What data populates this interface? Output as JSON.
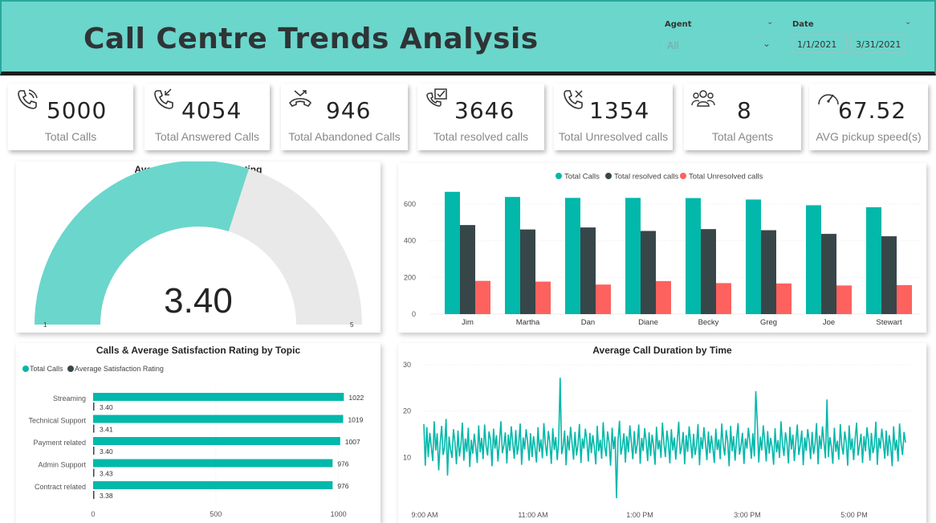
{
  "header": {
    "title": "Call Centre Trends Analysis",
    "agent_label": "Agent",
    "agent_value": "All",
    "date_label": "Date",
    "date_start": "1/1/2021",
    "date_end": "3/31/2021"
  },
  "kpis": [
    {
      "value": "5000",
      "label": "Total Calls",
      "icon": "phone-call-icon"
    },
    {
      "value": "4054",
      "label": "Total Answered Calls",
      "icon": "phone-incoming-icon"
    },
    {
      "value": "946",
      "label": "Total Abandoned Calls",
      "icon": "phone-hangup-icon"
    },
    {
      "value": "3646",
      "label": "Total resolved calls",
      "icon": "resolved-check-icon"
    },
    {
      "value": "1354",
      "label": "Total Unresolved calls",
      "icon": "phone-missed-icon"
    },
    {
      "value": "8",
      "label": "Total Agents",
      "icon": "agents-group-icon"
    },
    {
      "value": "67.52",
      "label": "AVG pickup speed(s)",
      "icon": "speedometer-icon"
    }
  ],
  "colors": {
    "teal": "#01b8aa",
    "dark": "#374649",
    "red": "#fd625e",
    "gauge_fill": "#6bd6cc",
    "gauge_bg": "#e9e9e9"
  },
  "chart_data": [
    {
      "type": "gauge",
      "title": "Average Satisfaction Rating",
      "value": 3.4,
      "value_label": "3.40",
      "min": 1,
      "max": 5,
      "min_label": "1",
      "max_label": "5"
    },
    {
      "type": "bar",
      "title": "",
      "categories": [
        "Jim",
        "Martha",
        "Dan",
        "Diane",
        "Becky",
        "Greg",
        "Joe",
        "Stewart"
      ],
      "series": [
        {
          "name": "Total Calls",
          "values": [
            666,
            638,
            633,
            633,
            632,
            624,
            593,
            582
          ]
        },
        {
          "name": "Total resolved calls",
          "values": [
            485,
            461,
            472,
            453,
            463,
            457,
            437,
            424
          ]
        },
        {
          "name": "Total Unresolved calls",
          "values": [
            181,
            177,
            161,
            180,
            169,
            167,
            156,
            158
          ]
        }
      ],
      "ylim": [
        0,
        700
      ],
      "yticks": [
        0,
        200,
        400,
        600
      ],
      "legend": "top-center"
    },
    {
      "type": "bar",
      "orientation": "horizontal",
      "title": "Calls & Average Satisfaction Rating by Topic",
      "categories": [
        "Streaming",
        "Technical Support",
        "Payment related",
        "Admin Support",
        "Contract related"
      ],
      "series": [
        {
          "name": "Total Calls",
          "values": [
            1022,
            1019,
            1007,
            976,
            976
          ]
        },
        {
          "name": "Average Satisfaction Rating",
          "values": [
            3.4,
            3.41,
            3.4,
            3.43,
            3.38
          ]
        }
      ],
      "value_labels": {
        "calls": [
          "1022",
          "1019",
          "1007",
          "976",
          "976"
        ],
        "rating": [
          "3.40",
          "3.41",
          "3.40",
          "3.43",
          "3.38"
        ]
      },
      "xlim": [
        0,
        1100
      ],
      "xticks": [
        0,
        500,
        1000
      ],
      "legend": "top-left"
    },
    {
      "type": "line",
      "title": "Average Call Duration  by Time",
      "xlabels": [
        "9:00 AM",
        "11:00 AM",
        "1:00 PM",
        "3:00 PM",
        "5:00 PM"
      ],
      "x_range_hours": [
        9,
        18.5
      ],
      "ylim": [
        0,
        30
      ],
      "yticks": [
        10,
        20,
        30
      ],
      "series": [
        {
          "values": [
            17.2,
            8.2,
            16.5,
            10.1,
            15.3,
            12.4,
            9.2,
            17.8,
            11.5,
            15.2,
            7.2,
            13.1,
            16.8,
            10.5,
            12.2,
            18.3,
            6.1,
            14.5,
            11.8,
            9.9,
            16.1,
            13.2,
            8.5,
            15.8,
            10.2,
            12.7,
            17.5,
            9.3,
            14.1,
            11.2,
            16.4,
            7.9,
            13.8,
            10.8,
            15.1,
            12.3,
            8.8,
            16.9,
            11.1,
            14.2,
            9.6,
            17.1,
            12.5,
            10.4,
            15.6,
            13.7,
            8.1,
            16.2,
            11.9,
            14.8,
            9.1,
            13.5,
            17.8,
            10.9,
            12.6,
            15.4,
            8.7,
            14.9,
            11.4,
            16.7,
            13.1,
            9.7,
            15.9,
            10.6,
            12.9,
            17.3,
            8.4,
            14.3,
            11.7,
            16.1,
            13.4,
            9.3,
            15.2,
            10.1,
            14.6,
            12.1,
            8.9,
            16.5,
            11.2,
            13.9,
            9.8,
            17.4,
            12.8,
            10.3,
            15.7,
            13.3,
            8.6,
            16.3,
            11.6,
            14.4,
            9.4,
            13.7,
            27.2,
            10.7,
            12.4,
            15.8,
            8.3,
            14.7,
            11.5,
            16.6,
            13.2,
            9.5,
            15.5,
            10.4,
            12.7,
            17.2,
            8.8,
            14.1,
            11.9,
            16.2,
            13.6,
            9.1,
            15.3,
            10.9,
            14.8,
            12.2,
            8.5,
            16.8,
            11.3,
            13.8,
            9.7,
            17.6,
            12.6,
            10.2,
            15.6,
            13.1,
            8.2,
            16.4,
            11.8,
            14.5,
            1.2,
            13.4,
            17.9,
            10.6,
            12.5,
            15.2,
            8.9,
            14.6,
            11.1,
            16.9,
            13.3,
            9.6,
            15.7,
            10.8,
            12.8,
            17.1,
            8.6,
            14.2,
            11.4,
            16.3,
            13.5,
            9.2,
            15.4,
            10.3,
            14.9,
            12.4,
            8.4,
            16.6,
            11.7,
            13.7,
            9.9,
            17.5,
            12.9,
            10.1,
            15.8,
            13.2,
            8.7,
            16.1,
            11.5,
            14.3,
            9.5,
            13.6,
            17.7,
            10.7,
            12.3,
            15.5,
            8.5,
            14.8,
            11.2,
            16.7,
            13.4,
            9.8,
            15.1,
            10.5,
            12.6,
            17.2,
            8.3,
            14.4,
            11.8,
            16.5,
            13.1,
            9.4,
            15.6,
            10.9,
            14.7,
            12.1,
            8.8,
            16.2,
            11.6,
            13.9,
            9.6,
            17.3,
            12.7,
            10.4,
            15.9,
            13.5,
            8.1,
            16.8,
            11.3,
            14.6,
            9.3,
            13.8,
            17.4,
            10.6,
            12.5,
            15.3,
            8.6,
            14.1,
            11.9,
            16.4,
            13.3,
            9.7,
            15.2,
            10.2,
            24.3,
            17.6,
            8.9,
            14.5,
            11.5,
            16.9,
            13.6,
            9.1,
            15.7,
            10.8,
            14.2,
            12.3,
            8.4,
            16.3,
            11.1,
            13.7,
            9.9,
            17.8,
            12.8,
            10.3,
            15.4,
            13.2,
            8.7,
            16.6,
            11.7,
            14.9,
            9.2,
            13.4,
            17.1,
            10.5,
            12.6,
            15.8,
            8.3,
            14.3,
            11.4,
            16.1,
            13.5,
            9.6,
            15.5,
            10.7,
            12.9,
            17.4,
            8.5,
            14.7,
            11.8,
            16.7,
            13.1,
            9.8,
            22.5,
            10.1,
            14.4,
            12.2,
            8.6,
            16.4,
            11.2,
            13.6,
            9.5,
            17.2,
            12.5,
            10.6,
            15.6,
            13.3,
            8.2,
            16.9,
            11.6,
            14.1,
            9.4,
            13.9,
            17.5,
            10.4,
            12.7,
            15.1,
            8.8,
            14.6,
            11.3,
            16.5,
            13.7,
            9.3,
            15.3,
            10.9,
            12.4,
            17.7,
            8.4,
            14.2,
            11.9,
            16.2,
            13.4,
            9.7,
            15.8,
            10.3,
            14.8,
            12.6,
            8.1,
            16.7,
            11.5,
            13.8,
            9.1,
            17.3,
            12.9,
            10.5,
            15.5,
            13.2
          ]
        }
      ]
    }
  ]
}
